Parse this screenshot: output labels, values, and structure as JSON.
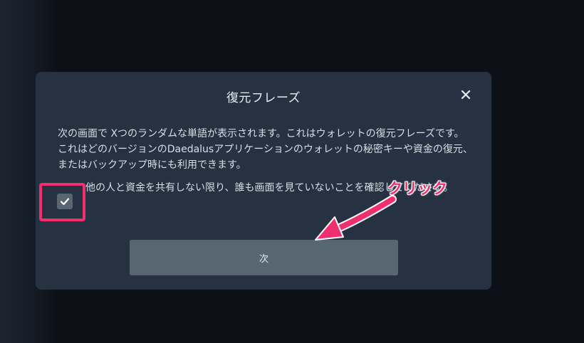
{
  "modal": {
    "title": "復元フレーズ",
    "body": "次の画面で Xつのランダムな単語が表示されます。これはウォレットの復元フレーズです。これはどのバージョンのDaedalusアプリケーションのウォレットの秘密キーや資金の復元、またはバックアップ時にも利用できます。",
    "confirm_text": "他の人と資金を共有しない限り、誰も画面を見ていないことを確認してください。",
    "checkbox_checked": true,
    "next_label": "次"
  },
  "annotation": {
    "label": "クリック",
    "color": "#f0306e"
  },
  "icons": {
    "close": "close-icon",
    "check": "checkmark-icon"
  }
}
